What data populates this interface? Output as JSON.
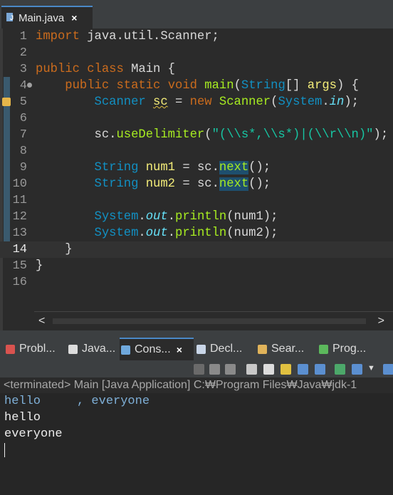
{
  "editor_tab": {
    "label": "Main.java",
    "close": "×"
  },
  "lines": [
    {
      "n": "1",
      "t": [
        [
          "kw",
          "import"
        ],
        [
          "plain",
          " java.util.Scanner;"
        ]
      ]
    },
    {
      "n": "2",
      "t": []
    },
    {
      "n": "3",
      "t": [
        [
          "kw",
          "public"
        ],
        [
          "plain",
          " "
        ],
        [
          "kw",
          "class"
        ],
        [
          "plain",
          " Main {"
        ]
      ]
    },
    {
      "n": "4",
      "t": [
        [
          "plain",
          "    "
        ],
        [
          "kw",
          "public"
        ],
        [
          "plain",
          " "
        ],
        [
          "kw",
          "static"
        ],
        [
          "plain",
          " "
        ],
        [
          "kw",
          "void"
        ],
        [
          "plain",
          " "
        ],
        [
          "mtd",
          "main"
        ],
        [
          "plain",
          "("
        ],
        [
          "cls",
          "String"
        ],
        [
          "plain",
          "[] "
        ],
        [
          "var",
          "args"
        ],
        [
          "plain",
          ") {"
        ]
      ]
    },
    {
      "n": "5",
      "t": [
        [
          "plain",
          "        "
        ],
        [
          "cls",
          "Scanner"
        ],
        [
          "plain",
          " "
        ],
        [
          "var warnline",
          "sc"
        ],
        [
          "plain",
          " = "
        ],
        [
          "kw",
          "new"
        ],
        [
          "plain",
          " "
        ],
        [
          "mtd",
          "Scanner"
        ],
        [
          "plain",
          "("
        ],
        [
          "cls",
          "System"
        ],
        [
          "plain",
          "."
        ],
        [
          "fld",
          "in"
        ],
        [
          "plain",
          ");"
        ]
      ]
    },
    {
      "n": "6",
      "t": []
    },
    {
      "n": "7",
      "t": [
        [
          "plain",
          "        sc."
        ],
        [
          "mtd",
          "useDelimiter"
        ],
        [
          "plain",
          "("
        ],
        [
          "str",
          "\"(\\\\s*,\\\\s*)|(\\\\r\\\\n)\""
        ],
        [
          "plain",
          ");"
        ]
      ]
    },
    {
      "n": "8",
      "t": []
    },
    {
      "n": "9",
      "t": [
        [
          "plain",
          "        "
        ],
        [
          "cls",
          "String"
        ],
        [
          "plain",
          " "
        ],
        [
          "var",
          "num1"
        ],
        [
          "plain",
          " = sc."
        ],
        [
          "hl",
          "next"
        ],
        [
          "plain",
          "();"
        ]
      ]
    },
    {
      "n": "10",
      "t": [
        [
          "plain",
          "        "
        ],
        [
          "cls",
          "String"
        ],
        [
          "plain",
          " "
        ],
        [
          "var",
          "num2"
        ],
        [
          "plain",
          " = sc."
        ],
        [
          "hl",
          "next"
        ],
        [
          "plain",
          "();"
        ]
      ]
    },
    {
      "n": "11",
      "t": []
    },
    {
      "n": "12",
      "t": [
        [
          "plain",
          "        "
        ],
        [
          "cls",
          "System"
        ],
        [
          "plain",
          "."
        ],
        [
          "fld",
          "out"
        ],
        [
          "plain",
          "."
        ],
        [
          "mtd",
          "println"
        ],
        [
          "plain",
          "(num1);"
        ]
      ]
    },
    {
      "n": "13",
      "t": [
        [
          "plain",
          "        "
        ],
        [
          "cls",
          "System"
        ],
        [
          "plain",
          "."
        ],
        [
          "fld",
          "out"
        ],
        [
          "plain",
          "."
        ],
        [
          "mtd",
          "println"
        ],
        [
          "plain",
          "(num2);"
        ]
      ]
    },
    {
      "n": "14",
      "t": [
        [
          "plain",
          "    }"
        ]
      ]
    },
    {
      "n": "15",
      "t": [
        [
          "plain",
          "}"
        ]
      ]
    },
    {
      "n": "16",
      "t": []
    }
  ],
  "console_tabs": [
    {
      "label": "Probl...",
      "icon": "problems-icon",
      "color": "#d9534f"
    },
    {
      "label": "Java...",
      "icon": "javadoc-icon",
      "color": "#dcdcdc"
    },
    {
      "label": "Cons...",
      "icon": "console-icon",
      "color": "#6fa8dc",
      "active": true,
      "close": "×"
    },
    {
      "label": "Decl...",
      "icon": "declaration-icon",
      "color": "#c9d6e8"
    },
    {
      "label": "Sear...",
      "icon": "search-icon",
      "color": "#e0b35a"
    },
    {
      "label": "Prog...",
      "icon": "progress-icon",
      "color": "#5cb85c"
    }
  ],
  "console_status": "<terminated> Main [Java Application] C:₩Program Files₩Java₩jdk-1",
  "console_output": [
    {
      "text": "hello     , everyone",
      "kind": "input"
    },
    {
      "text": "hello",
      "kind": "output"
    },
    {
      "text": "everyone",
      "kind": "output"
    }
  ],
  "colors": {
    "accent": "#4a88c7",
    "editor_bg": "#2b2b2b",
    "console_input": "#7fb0d8"
  }
}
